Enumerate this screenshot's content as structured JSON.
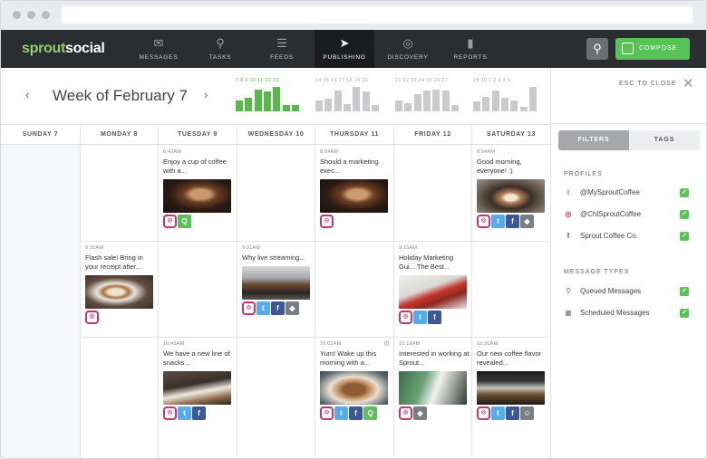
{
  "nav": {
    "logo_a": "sprout",
    "logo_b": "social",
    "items": [
      {
        "label": "MESSAGES",
        "icon": "envelope-icon"
      },
      {
        "label": "TASKS",
        "icon": "pin-icon"
      },
      {
        "label": "FEEDS",
        "icon": "list-icon"
      },
      {
        "label": "PUBLISHING",
        "icon": "paper-plane-icon"
      },
      {
        "label": "DISCOVERY",
        "icon": "compass-icon"
      },
      {
        "label": "REPORTS",
        "icon": "bar-chart-icon"
      }
    ],
    "active": "PUBLISHING",
    "compose_label": "COMPOSE"
  },
  "week": {
    "title": "Week of February 7",
    "prev": "‹",
    "next": "›",
    "histograms": [
      {
        "days": "7 8 9 10 11 12 13",
        "current": true,
        "levels": [
          0.45,
          0.55,
          0.9,
          0.8,
          1.0,
          0.25,
          0.25
        ]
      },
      {
        "days": "14 15 16 17 18 19 20",
        "current": false,
        "levels": [
          0.45,
          0.5,
          0.85,
          0.3,
          1.0,
          0.8,
          0.25
        ]
      },
      {
        "days": "21 22 23 24 25 26 27",
        "current": false,
        "levels": [
          0.45,
          0.35,
          0.7,
          0.85,
          0.9,
          0.85,
          0.25
        ]
      },
      {
        "days": "28 29 1 2 3 4 5",
        "current": false,
        "levels": [
          0.4,
          0.6,
          0.85,
          0.55,
          0.45,
          0.2,
          1.0
        ]
      }
    ]
  },
  "days": [
    "SUNDAY 7",
    "MONDAY 8",
    "TUESDAY 9",
    "WEDNESDAY 10",
    "THURSDAY 11",
    "FRIDAY 12",
    "SATURDAY 13"
  ],
  "posts": [
    {
      "col": 2,
      "row": 0,
      "time": "8:43AM",
      "text": "Enjoy a cup of coffee with a...",
      "image": "man",
      "icons": [
        "ig",
        "q"
      ]
    },
    {
      "col": 4,
      "row": 0,
      "time": "8:04AM",
      "text": "Should a marketing exec...",
      "image": "man",
      "icons": [
        "ig"
      ]
    },
    {
      "col": 6,
      "row": 0,
      "time": "8:54AM",
      "text": "Good morning, everyone! :)",
      "image": "cup",
      "icons": [
        "ig",
        "tw",
        "fb",
        "tag"
      ]
    },
    {
      "col": 1,
      "row": 1,
      "time": "9:30AM",
      "text": "Flash sale! Bring in your receipt after...",
      "image": "latte",
      "icons": [
        "ig"
      ]
    },
    {
      "col": 3,
      "row": 1,
      "time": "9:21AM",
      "text": "Why live streaming...",
      "image": "espresso",
      "icons": [
        "ig",
        "tw",
        "fb",
        "tag"
      ]
    },
    {
      "col": 5,
      "row": 1,
      "time": "9:15AM",
      "text": "Holiday Marketing Gui... The Best...",
      "image": "laptop",
      "icons": [
        "ig",
        "tw",
        "fb"
      ]
    },
    {
      "col": 2,
      "row": 2,
      "time": "10:43AM",
      "text": "We have a new line of snacks...",
      "image": "snack",
      "icons": [
        "ig",
        "tw",
        "fb"
      ]
    },
    {
      "col": 4,
      "row": 2,
      "time": "10:02AM",
      "text": "Yum! Wake up this morning with a...",
      "image": "pastry",
      "icons": [
        "ig",
        "tw",
        "fb",
        "q"
      ],
      "gear": true
    },
    {
      "col": 5,
      "row": 2,
      "time": "10:18AM",
      "text": "Interested in working at Sprout...",
      "image": "work",
      "icons": [
        "ig",
        "tag"
      ]
    },
    {
      "col": 6,
      "row": 2,
      "time": "10:30AM",
      "text": "Our new coffee flavor revealed...",
      "image": "machine",
      "icons": [
        "ig",
        "tw",
        "fb",
        "usr"
      ]
    }
  ],
  "panel": {
    "esc_label": "ESC TO CLOSE",
    "tab_filters": "FILTERS",
    "tab_tags": "TAGS",
    "profiles_heading": "PROFILES",
    "profiles": [
      {
        "label": "@MySproutCoffee",
        "network": "twitter"
      },
      {
        "label": "@ChlSproutCoffee",
        "network": "instagram"
      },
      {
        "label": "Sprout Coffee Co.",
        "network": "facebook"
      }
    ],
    "types_heading": "MESSAGE TYPES",
    "types": [
      {
        "label": "Queued Messages",
        "icon": "queue-icon"
      },
      {
        "label": "Scheduled Messages",
        "icon": "calendar-icon"
      }
    ]
  },
  "colors": {
    "accent": "#59c35a",
    "nav_bg": "#2b2e30",
    "twitter": "#55acee",
    "facebook": "#3b5998",
    "instagram": "#c8336a"
  }
}
